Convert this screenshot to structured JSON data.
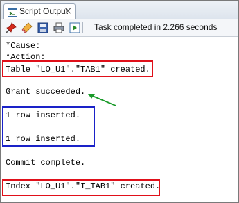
{
  "tab": {
    "label": "Script Output",
    "close": "×"
  },
  "toolbar": {
    "buttons": [
      "pin-icon",
      "eraser-icon",
      "save-icon",
      "print-icon",
      "run-script-icon"
    ],
    "status": "Task completed in 2.266 seconds"
  },
  "output": {
    "lines": {
      "cause": "*Cause:",
      "action": "*Action:",
      "table_created": "Table \"LO_U1\".\"TAB1\" created.",
      "grant": "Grant succeeded.",
      "row1": "1 row inserted.",
      "row2": "1 row inserted.",
      "commit": "Commit complete.",
      "index_created": "Index \"LO_U1\".\"I_TAB1\" created."
    }
  },
  "annotations": {
    "red_color": "#e0101a",
    "blue_color": "#1a22c8",
    "arrow_color": "#1a9a2a"
  }
}
